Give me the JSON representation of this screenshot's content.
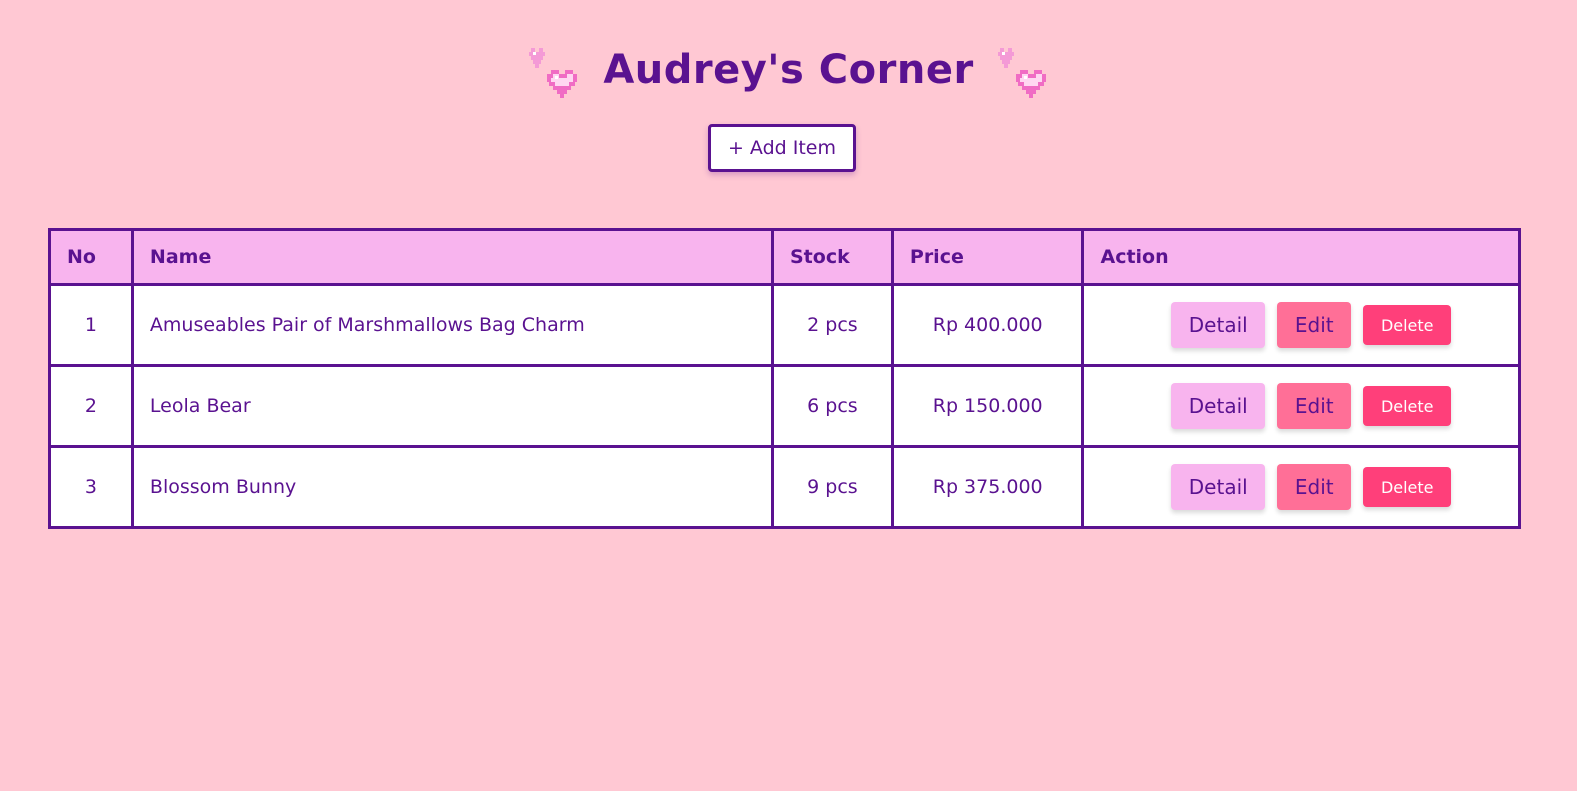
{
  "header": {
    "title": "Audrey's Corner",
    "decoration_icon": "pixel-hearts-icon"
  },
  "toolbar": {
    "add_item_label": "+ Add Item"
  },
  "table": {
    "columns": [
      "No",
      "Name",
      "Stock",
      "Price",
      "Action"
    ],
    "rows": [
      {
        "no": "1",
        "name": "Amuseables Pair of Marshmallows Bag Charm",
        "stock": "2 pcs",
        "price": "Rp 400.000"
      },
      {
        "no": "2",
        "name": "Leola Bear",
        "stock": "6 pcs",
        "price": "Rp 150.000"
      },
      {
        "no": "3",
        "name": "Blossom Bunny",
        "stock": "9 pcs",
        "price": "Rp 375.000"
      }
    ]
  },
  "actions": {
    "detail_label": "Detail",
    "edit_label": "Edit",
    "delete_label": "Delete"
  },
  "colors": {
    "background": "#ffc8d3",
    "accent_purple": "#5a1290",
    "header_pink": "#f8b4ee",
    "edit_pink": "#ff6f97",
    "delete_pink": "#ff3f7a"
  }
}
